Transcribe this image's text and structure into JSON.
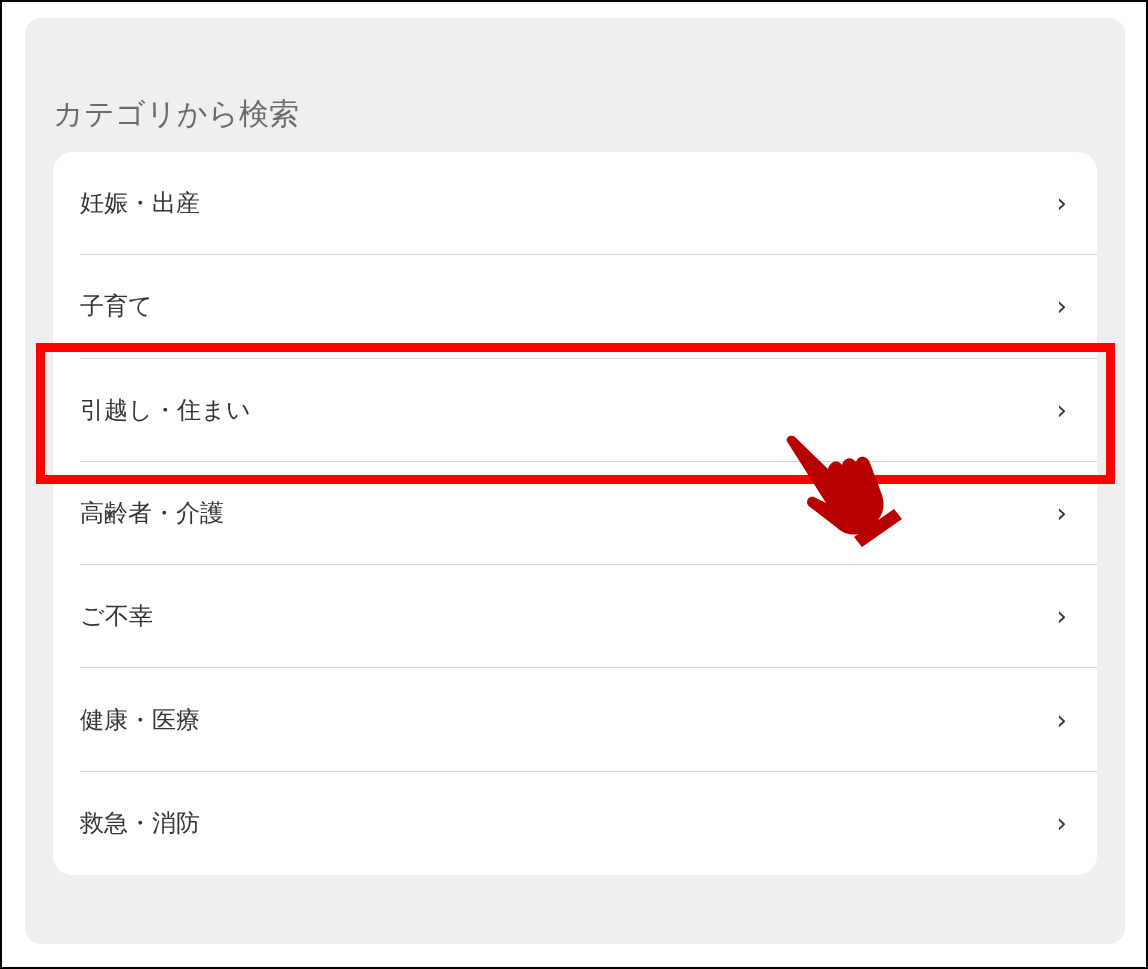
{
  "heading": "カテゴリから検索",
  "categories": [
    {
      "label": "妊娠・出産",
      "chevron": "›",
      "highlighted": false
    },
    {
      "label": "子育て",
      "chevron": "›",
      "highlighted": false
    },
    {
      "label": "引越し・住まい",
      "chevron": "›",
      "highlighted": true
    },
    {
      "label": "高齢者・介護",
      "chevron": "›",
      "highlighted": false
    },
    {
      "label": "ご不幸",
      "chevron": "›",
      "highlighted": false
    },
    {
      "label": "健康・医療",
      "chevron": "›",
      "highlighted": false
    },
    {
      "label": "救急・消防",
      "chevron": "›",
      "highlighted": false
    }
  ]
}
